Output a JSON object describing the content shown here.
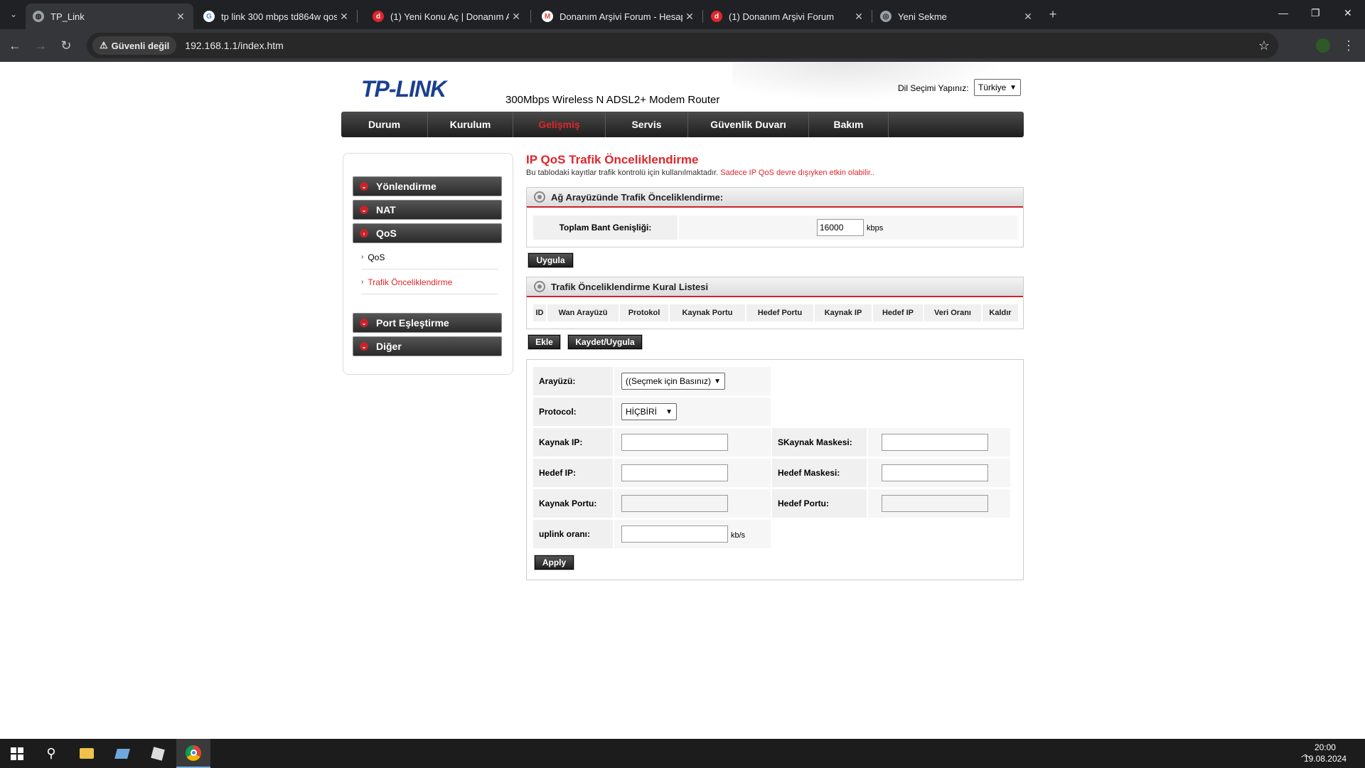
{
  "browser": {
    "tabs": [
      {
        "title": "TP_Link",
        "active": true
      },
      {
        "title": "tp link 300 mbps td864w qos ay"
      },
      {
        "title": "(1) Yeni Konu Aç | Donanım Arşi"
      },
      {
        "title": "Donanım Arşivi Forum - Hesap"
      },
      {
        "title": "(1) Donanım Arşivi Forum"
      },
      {
        "title": "Yeni Sekme"
      }
    ],
    "security_label": "Güvenli değil",
    "url": "192.168.1.1/index.htm"
  },
  "header": {
    "logo": "TP-LINK",
    "model": "300Mbps Wireless N ADSL2+ Modem Router",
    "language_label": "Dil Seçimi Yapınız:",
    "language_value": "Türkiye"
  },
  "main_nav": [
    {
      "label": "Durum"
    },
    {
      "label": "Kurulum"
    },
    {
      "label": "Gelişmiş",
      "active": true
    },
    {
      "label": "Servis"
    },
    {
      "label": "Güvenlik Duvarı"
    },
    {
      "label": "Bakım"
    }
  ],
  "sidebar": {
    "sections": [
      "Yönlendirme",
      "NAT",
      "QoS",
      "Port Eşleştirme",
      "Diğer"
    ],
    "qos_items": [
      "QoS",
      "Trafik Önceliklendirme"
    ]
  },
  "content": {
    "title": "IP QoS Trafik Önceliklendirme",
    "description": "Bu tablodaki kayıtlar trafik kontrolü için kullanılmaktadır.",
    "warning": "Sadece IP QoS devre dışıyken etkin olabilir..",
    "bandwidth_panel": {
      "title": "Ağ Arayüzünde Trafik Önceliklendirme:",
      "label": "Toplam Bant Genişliği:",
      "value": "16000",
      "unit": "kbps",
      "apply_button": "Uygula"
    },
    "rules_panel": {
      "title": "Trafik Önceliklendirme Kural Listesi",
      "columns": [
        "ID",
        "Wan Arayüzü",
        "Protokol",
        "Kaynak Portu",
        "Hedef Portu",
        "Kaynak IP",
        "Hedef IP",
        "Veri Oranı",
        "Kaldır"
      ],
      "add_button": "Ekle",
      "save_button": "Kaydet/Uygula"
    },
    "form": {
      "interface_label": "Arayüzü:",
      "interface_value": "((Seçmek için Basınız)",
      "protocol_label": "Protocol:",
      "protocol_value": "HİÇBİRİ",
      "src_ip_label": "Kaynak IP:",
      "src_mask_label": "SKaynak Maskesi:",
      "dst_ip_label": "Hedef IP:",
      "dst_mask_label": "Hedef Maskesi:",
      "src_port_label": "Kaynak Portu:",
      "dst_port_label": "Hedef Portu:",
      "uplink_label": "uplink oranı:",
      "uplink_unit": "kb/s",
      "apply_button": "Apply"
    }
  },
  "taskbar": {
    "time": "20:00",
    "date": "19.08.2024"
  }
}
